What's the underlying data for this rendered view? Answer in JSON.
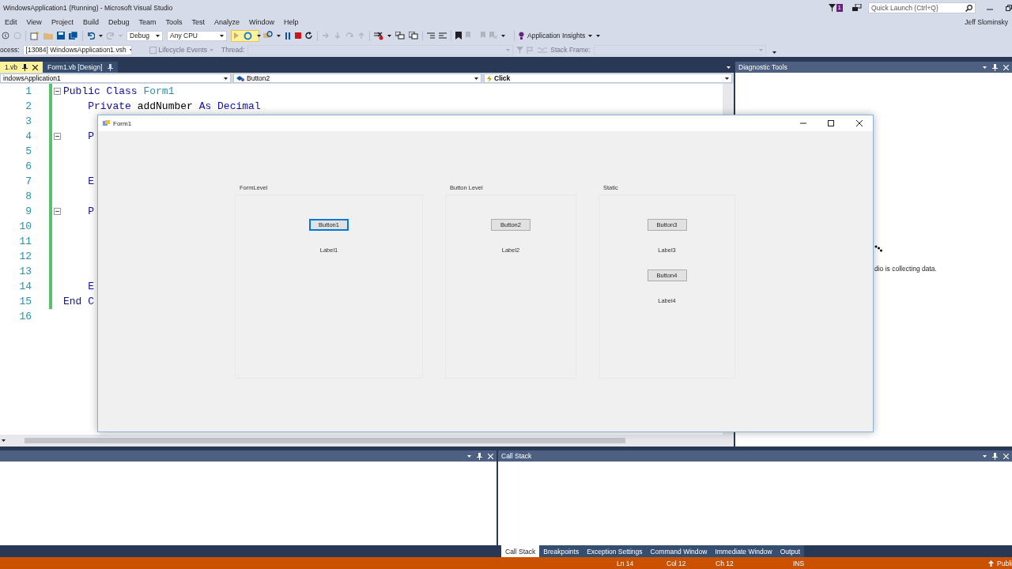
{
  "window": {
    "title": "WindowsApplication1 (Running) - Microsoft Visual Studio"
  },
  "title_bar": {
    "notification_count": "1",
    "quick_launch": {
      "placeholder": "Quick Launch (Ctrl+Q)"
    }
  },
  "menu": [
    "Edit",
    "View",
    "Project",
    "Build",
    "Debug",
    "Team",
    "Tools",
    "Test",
    "Analyze",
    "Window",
    "Help"
  ],
  "user": "Jeff Slominsky",
  "toolbar": {
    "configuration": "Debug",
    "platform": "Any CPU",
    "insights": "Application Insights"
  },
  "debug_location": {
    "process_label": "ocess:",
    "process": "[13084] WindowsApplication1.vsh",
    "lifecycle": "Lifecycle Events",
    "thread_label": "Thread:",
    "stack_frame_label": "Stack Frame:"
  },
  "document_tabs": [
    {
      "label": "1.vb",
      "selected": true
    },
    {
      "label": "Form1.vb [Design]",
      "selected": false
    }
  ],
  "nav_bar": {
    "project": "indowsApplication1",
    "member": "Button2",
    "event": "Click"
  },
  "editor": {
    "lines": [
      {
        "number": "1",
        "fold": true,
        "code": [
          {
            "kind": "keyword",
            "text": "Public Class "
          },
          {
            "kind": "type",
            "text": "Form1"
          }
        ]
      },
      {
        "number": "2",
        "fold": false,
        "code": [
          {
            "kind": "keyword",
            "text": "    Private "
          },
          {
            "kind": "plain",
            "text": "addNumber "
          },
          {
            "kind": "keyword",
            "text": "As Decimal"
          }
        ]
      },
      {
        "number": "3",
        "fold": false
      },
      {
        "number": "4",
        "fold": true,
        "code": [
          {
            "kind": "keyword",
            "text": "    P"
          }
        ]
      },
      {
        "number": "5",
        "fold": false
      },
      {
        "number": "6",
        "fold": false
      },
      {
        "number": "7",
        "fold": false,
        "code": [
          {
            "kind": "keyword",
            "text": "    E"
          }
        ]
      },
      {
        "number": "8",
        "fold": false
      },
      {
        "number": "9",
        "fold": true,
        "code": [
          {
            "kind": "keyword",
            "text": "    P"
          }
        ]
      },
      {
        "number": "10",
        "fold": false
      },
      {
        "number": "11",
        "fold": false
      },
      {
        "number": "12",
        "fold": false
      },
      {
        "number": "13",
        "fold": false
      },
      {
        "number": "14",
        "fold": false,
        "code": [
          {
            "kind": "keyword",
            "text": "    E"
          }
        ]
      },
      {
        "number": "15",
        "fold": false,
        "code": [
          {
            "kind": "keyword",
            "text": "End C"
          }
        ]
      },
      {
        "number": "16",
        "fold": false
      }
    ]
  },
  "diagnostic_tools": {
    "title": "Diagnostic Tools",
    "status": "dio is collecting data."
  },
  "call_stack": {
    "title": "Call Stack",
    "tabs": [
      {
        "label": "Call Stack",
        "selected": true
      },
      {
        "label": "Breakpoints",
        "selected": false
      },
      {
        "label": "Exception Settings",
        "selected": false
      },
      {
        "label": "Command Window",
        "selected": false
      },
      {
        "label": "Immediate Window",
        "selected": false
      },
      {
        "label": "Output",
        "selected": false
      }
    ]
  },
  "status_bar": {
    "line": "Ln 14",
    "column": "Col 12",
    "char": "Ch 12",
    "mode": "INS",
    "publish": "Publi"
  },
  "form_window": {
    "title": "Form1",
    "groups": [
      {
        "title": "FormLevel",
        "controls": [
          {
            "kind": "button",
            "text": "Button1",
            "focused": true
          },
          {
            "kind": "label",
            "text": "Label1"
          }
        ]
      },
      {
        "title": "Button Level",
        "controls": [
          {
            "kind": "button",
            "text": "Button2",
            "focused": false
          },
          {
            "kind": "label",
            "text": "Label2"
          }
        ]
      },
      {
        "title": "Static",
        "controls": [
          {
            "kind": "button",
            "text": "Button3",
            "focused": false
          },
          {
            "kind": "label",
            "text": "Label3"
          },
          {
            "kind": "button",
            "text": "Button4",
            "focused": false
          },
          {
            "kind": "label",
            "text": "Label4"
          }
        ]
      }
    ]
  }
}
